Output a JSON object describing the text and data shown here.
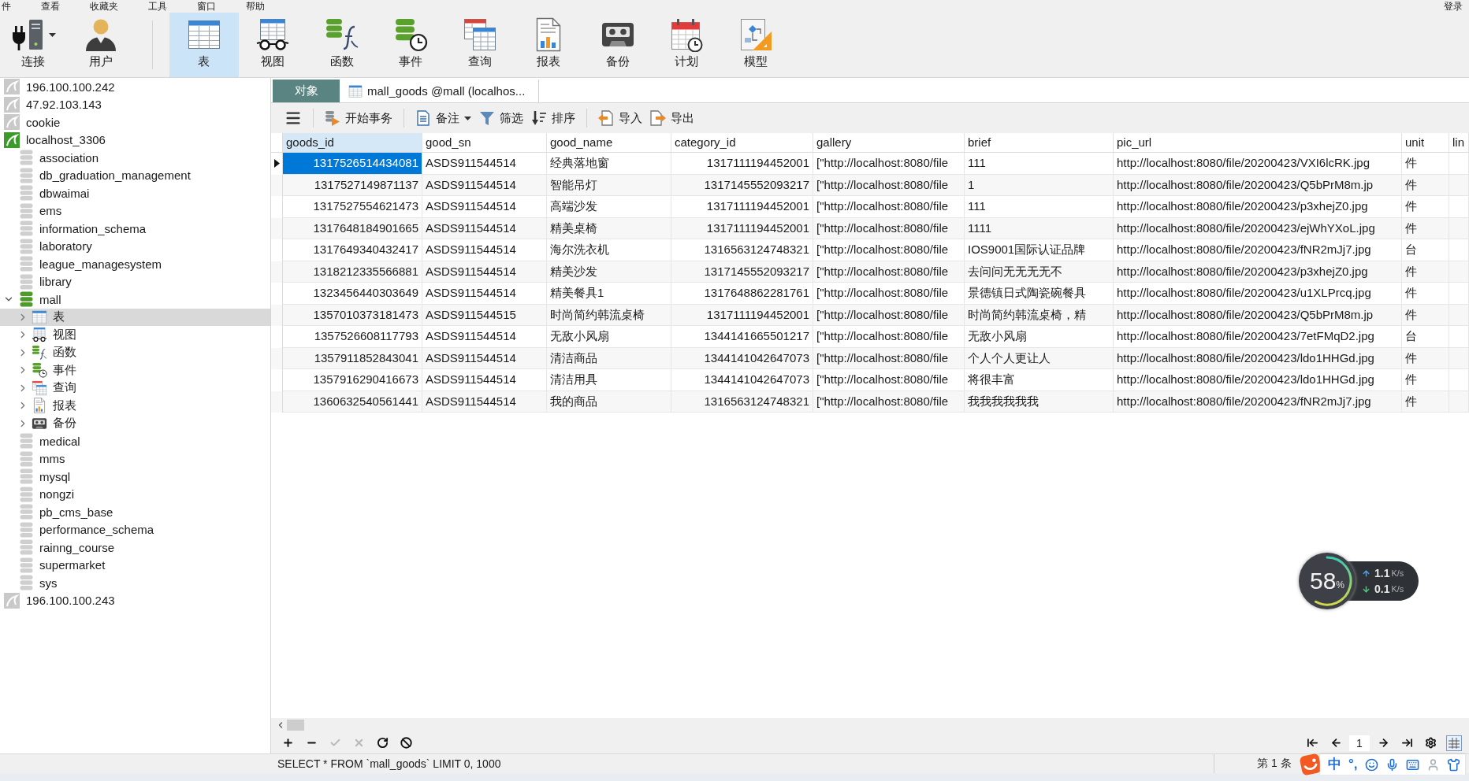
{
  "menu": {
    "items": [
      "件",
      "查看",
      "收藏夹",
      "工具",
      "窗口",
      "帮助"
    ],
    "login": "登录"
  },
  "toolbar": [
    {
      "kind": "connect",
      "label": "连接",
      "selected": false
    },
    {
      "kind": "user",
      "label": "用户",
      "selected": false
    },
    {
      "kind": "table",
      "label": "表",
      "selected": true
    },
    {
      "kind": "view",
      "label": "视图",
      "selected": false
    },
    {
      "kind": "function",
      "label": "函数",
      "selected": false
    },
    {
      "kind": "event",
      "label": "事件",
      "selected": false
    },
    {
      "kind": "query",
      "label": "查询",
      "selected": false
    },
    {
      "kind": "report",
      "label": "报表",
      "selected": false
    },
    {
      "kind": "backup",
      "label": "备份",
      "selected": false
    },
    {
      "kind": "schedule",
      "label": "计划",
      "selected": false
    },
    {
      "kind": "model",
      "label": "模型",
      "selected": false
    }
  ],
  "sidebar": {
    "connections": [
      {
        "name": "196.100.100.242",
        "connected": false
      },
      {
        "name": "47.92.103.143",
        "connected": false
      },
      {
        "name": "cookie",
        "connected": false
      },
      {
        "name": "localhost_3306",
        "connected": true,
        "databases": [
          {
            "name": "association",
            "open": false
          },
          {
            "name": "db_graduation_management",
            "open": false
          },
          {
            "name": "dbwaimai",
            "open": false
          },
          {
            "name": "ems",
            "open": false
          },
          {
            "name": "information_schema",
            "open": false
          },
          {
            "name": "laboratory",
            "open": false
          },
          {
            "name": "league_managesystem",
            "open": false
          },
          {
            "name": "library",
            "open": false
          },
          {
            "name": "mall",
            "open": true,
            "expanded": true,
            "children": [
              {
                "kind": "table",
                "label": "表",
                "expanded": false,
                "selected": true
              },
              {
                "kind": "view",
                "label": "视图",
                "expanded": false,
                "selected": false
              },
              {
                "kind": "function",
                "label": "函数",
                "expanded": false,
                "selected": false
              },
              {
                "kind": "event",
                "label": "事件",
                "expanded": false,
                "selected": false
              },
              {
                "kind": "query",
                "label": "查询",
                "expanded": false,
                "selected": false
              },
              {
                "kind": "report",
                "label": "报表",
                "expanded": false,
                "selected": false
              },
              {
                "kind": "backup",
                "label": "备份",
                "expanded": false,
                "selected": false
              }
            ]
          },
          {
            "name": "medical",
            "open": false
          },
          {
            "name": "mms",
            "open": false
          },
          {
            "name": "mysql",
            "open": false
          },
          {
            "name": "nongzi",
            "open": false
          },
          {
            "name": "pb_cms_base",
            "open": false
          },
          {
            "name": "performance_schema",
            "open": false
          },
          {
            "name": "rainng_course",
            "open": false
          },
          {
            "name": "supermarket",
            "open": false
          },
          {
            "name": "sys",
            "open": false
          }
        ]
      },
      {
        "name": "196.100.100.243",
        "connected": false
      }
    ]
  },
  "tabs": [
    {
      "kind": "objects",
      "label": "对象",
      "selected": false
    },
    {
      "kind": "table",
      "label": "mall_goods @mall (localhos...",
      "selected": true
    }
  ],
  "object_toolbar": [
    {
      "kind": "menu"
    },
    {
      "kind": "begin-transaction",
      "label": "开始事务"
    },
    {
      "kind": "memo",
      "label": "备注"
    },
    {
      "kind": "filter",
      "label": "筛选"
    },
    {
      "kind": "sort",
      "label": "排序"
    },
    {
      "kind": "import",
      "label": "导入"
    },
    {
      "kind": "export",
      "label": "导出"
    }
  ],
  "table": {
    "columns": [
      {
        "label": "goods_id",
        "kind": "number",
        "selected": true
      },
      {
        "label": "good_sn",
        "kind": "text",
        "selected": false
      },
      {
        "label": "good_name",
        "kind": "text",
        "selected": false
      },
      {
        "label": "category_id",
        "kind": "number",
        "selected": false
      },
      {
        "label": "gallery",
        "kind": "text",
        "selected": false
      },
      {
        "label": "brief",
        "kind": "text",
        "selected": false
      },
      {
        "label": "pic_url",
        "kind": "text",
        "selected": false
      },
      {
        "label": "unit",
        "kind": "text",
        "selected": false
      },
      {
        "label": "lin",
        "selected": false
      }
    ],
    "rows": [
      {
        "selected": true,
        "cells": [
          "1317526514434081",
          "ASDS911544514",
          "经典落地窗",
          "1317111194452001",
          "[\"http://localhost:8080/file",
          "111",
          "http://localhost:8080/file/20200423/VXI6lcRK.jpg",
          "件"
        ]
      },
      {
        "selected": false,
        "cells": [
          "1317527149871137",
          "ASDS911544514",
          "智能吊灯",
          "1317145552093217",
          "[\"http://localhost:8080/file",
          "1",
          "http://localhost:8080/file/20200423/Q5bPrM8m.jp",
          "件"
        ]
      },
      {
        "selected": false,
        "cells": [
          "1317527554621473",
          "ASDS911544514",
          "高端沙发",
          "1317111194452001",
          "[\"http://localhost:8080/file",
          "111",
          "http://localhost:8080/file/20200423/p3xhejZ0.jpg",
          "件"
        ]
      },
      {
        "selected": false,
        "cells": [
          "1317648184901665",
          "ASDS911544514",
          "精美桌椅",
          "1317111194452001",
          "[\"http://localhost:8080/file",
          "1111",
          "http://localhost:8080/file/20200423/ejWhYXoL.jpg",
          "件"
        ]
      },
      {
        "selected": false,
        "cells": [
          "1317649340432417",
          "ASDS911544514",
          "海尔洗衣机",
          "1316563124748321",
          "[\"http://localhost:8080/file",
          "IOS9001国际认证品牌",
          "http://localhost:8080/file/20200423/fNR2mJj7.jpg",
          "台"
        ]
      },
      {
        "selected": false,
        "cells": [
          "1318212335566881",
          "ASDS911544514",
          "精美沙发",
          "1317145552093217",
          "[\"http://localhost:8080/file",
          "去问问无无无无不",
          "http://localhost:8080/file/20200423/p3xhejZ0.jpg",
          "件"
        ]
      },
      {
        "selected": false,
        "cells": [
          "1323456440303649",
          "ASDS911544514",
          "精美餐具1",
          "1317648862281761",
          "[\"http://localhost:8080/file",
          "景德镇日式陶瓷碗餐具",
          "http://localhost:8080/file/20200423/u1XLPrcq.jpg",
          "件"
        ]
      },
      {
        "selected": false,
        "cells": [
          "1357010373181473",
          "ASDS911544515",
          "时尚简约韩流桌椅",
          "1317111194452001",
          "[\"http://localhost:8080/file",
          "时尚简约韩流桌椅，精",
          "http://localhost:8080/file/20200423/Q5bPrM8m.jp",
          "件"
        ]
      },
      {
        "selected": false,
        "cells": [
          "1357526608117793",
          "ASDS911544514",
          "无敌小风扇",
          "1344141665501217",
          "[\"http://localhost:8080/file",
          "无敌小风扇",
          "http://localhost:8080/file/20200423/7etFMqD2.jpg",
          "台"
        ]
      },
      {
        "selected": false,
        "cells": [
          "1357911852843041",
          "ASDS911544514",
          "清洁商品",
          "1344141042647073",
          "[\"http://localhost:8080/file",
          "个人个人更让人",
          "http://localhost:8080/file/20200423/ldo1HHGd.jpg",
          "件"
        ]
      },
      {
        "selected": false,
        "cells": [
          "1357916290416673",
          "ASDS911544514",
          "清洁用具",
          "1344141042647073",
          "[\"http://localhost:8080/file",
          "将很丰富",
          "http://localhost:8080/file/20200423/ldo1HHGd.jpg",
          "件"
        ]
      },
      {
        "selected": false,
        "cells": [
          "1360632540561441",
          "ASDS911544514",
          "我的商品",
          "1316563124748321",
          "[\"http://localhost:8080/file",
          "我我我我我我",
          "http://localhost:8080/file/20200423/fNR2mJj7.jpg",
          "件"
        ]
      }
    ]
  },
  "record_bar": {
    "actions": [
      {
        "kind": "add",
        "disabled": false
      },
      {
        "kind": "delete",
        "disabled": false
      },
      {
        "kind": "apply",
        "disabled": true
      },
      {
        "kind": "discard",
        "disabled": true
      },
      {
        "kind": "refresh",
        "disabled": false
      },
      {
        "kind": "stop",
        "disabled": false
      }
    ],
    "pager": [
      {
        "kind": "first"
      },
      {
        "kind": "previous"
      },
      {
        "kind": "page",
        "value": "1"
      },
      {
        "kind": "next"
      },
      {
        "kind": "last"
      },
      {
        "kind": "settings"
      },
      {
        "kind": "grid-view"
      }
    ]
  },
  "status_bar": {
    "sql": "SELECT * FROM `mall_goods` LIMIT 0, 1000",
    "record_info": "第 1 条"
  },
  "ime": {
    "mode": "中",
    "punctuation": "°,"
  },
  "net_monitor": {
    "level": 0.58,
    "percent": "58",
    "percent_unit": "%",
    "upload": "1.1",
    "upload_unit": "K/s",
    "download": "0.1",
    "download_unit": "K/s"
  }
}
